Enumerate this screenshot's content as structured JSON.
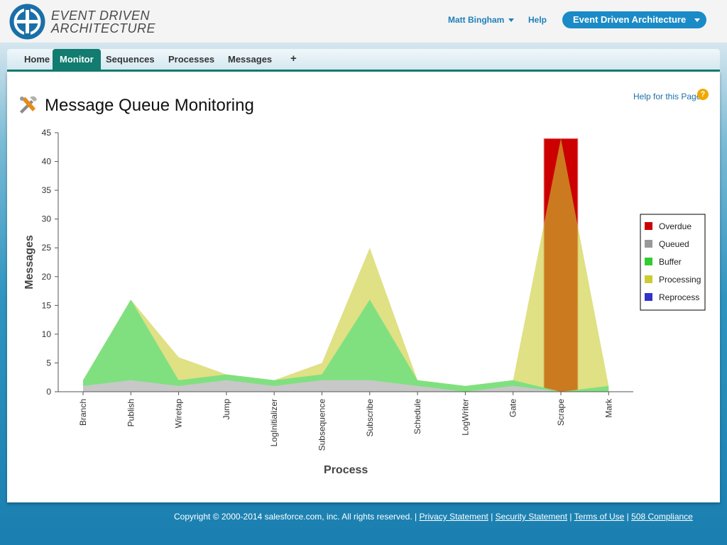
{
  "header": {
    "logo_line1": "EVENT DRIVEN",
    "logo_line2": "ARCHITECTURE",
    "user_name": "Matt Bingham",
    "help_label": "Help",
    "app_name": "Event Driven Architecture"
  },
  "tabs": [
    {
      "label": "Home",
      "active": false
    },
    {
      "label": "Monitor",
      "active": true
    },
    {
      "label": "Sequences",
      "active": false
    },
    {
      "label": "Processes",
      "active": false
    },
    {
      "label": "Messages",
      "active": false
    },
    {
      "label": "+",
      "active": false
    }
  ],
  "page": {
    "title": "Message Queue Monitoring",
    "help_link": "Help for this Page",
    "help_icon": "?"
  },
  "footer": {
    "copyright": "Copyright © 2000-2014 salesforce.com, inc. All rights reserved. |",
    "privacy": "Privacy Statement",
    "security": "Security Statement",
    "terms": "Terms of Use",
    "compliance": "508 Compliance",
    "sep": "|"
  },
  "colors": {
    "overdue": "#cc0000",
    "queued": "#999999",
    "buffer": "#33cc33",
    "processing": "#cccc33",
    "reprocess": "#3333cc",
    "tab_active": "#117c6f",
    "link": "#1e80b8"
  },
  "chart_data": {
    "type": "area",
    "xlabel": "Process",
    "ylabel": "Messages",
    "ylim": [
      0,
      45
    ],
    "yticks": [
      0,
      5,
      10,
      15,
      20,
      25,
      30,
      35,
      40,
      45
    ],
    "categories": [
      "Branch",
      "Publish",
      "Wiretap",
      "Jump",
      "LogInitializer",
      "Subsequence",
      "Subscribe",
      "Schedule",
      "LogWriter",
      "Gate",
      "Scrape",
      "Mark"
    ],
    "legend_position": "right",
    "series": [
      {
        "name": "Overdue",
        "type": "bar",
        "color": "#cc0000",
        "values": [
          0,
          0,
          0,
          0,
          0,
          0,
          0,
          0,
          0,
          0,
          44,
          0
        ]
      },
      {
        "name": "Queued",
        "color": "#999999",
        "values": [
          1,
          2,
          1,
          2,
          1,
          2,
          2,
          1,
          0,
          1,
          0,
          0
        ]
      },
      {
        "name": "Buffer",
        "color": "#33cc33",
        "values": [
          2,
          16,
          2,
          3,
          2,
          3,
          16,
          2,
          1,
          2,
          0,
          1
        ]
      },
      {
        "name": "Processing",
        "color": "#cccc33",
        "values": [
          2,
          16,
          6,
          3,
          2,
          5,
          25,
          2,
          1,
          2,
          44,
          1
        ]
      },
      {
        "name": "Reprocess",
        "color": "#3333cc",
        "values": [
          0,
          0,
          0,
          0,
          0,
          0,
          0,
          0,
          0,
          0,
          0,
          0
        ]
      }
    ]
  }
}
